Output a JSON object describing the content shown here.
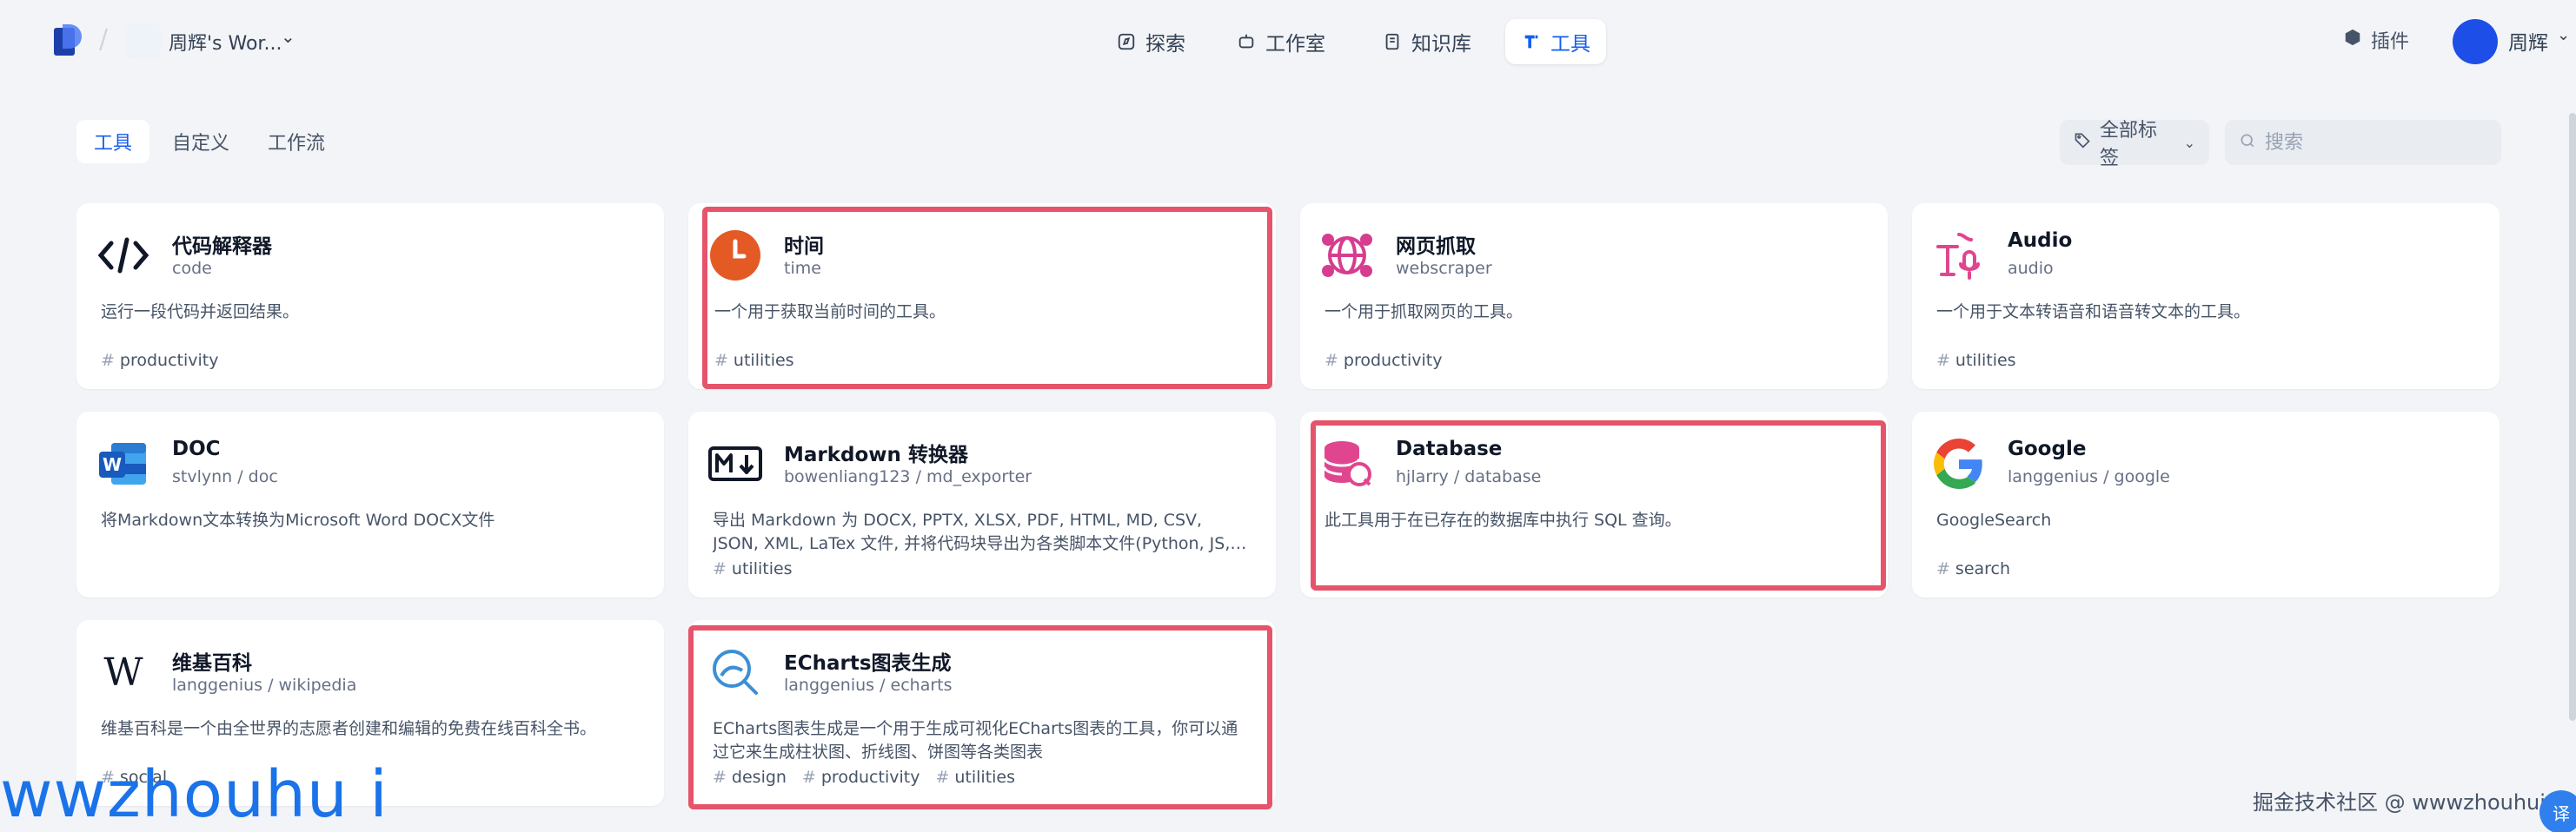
{
  "header": {
    "workspace_name": "周辉's Wor...",
    "nav": [
      {
        "label": "探索"
      },
      {
        "label": "工作室"
      },
      {
        "label": "知识库"
      },
      {
        "label": "工具"
      }
    ],
    "plugin_label": "插件",
    "user_name": "周辉"
  },
  "toolbar": {
    "tabs": [
      {
        "label": "工具"
      },
      {
        "label": "自定义"
      },
      {
        "label": "工作流"
      }
    ],
    "tag_filter_label": "全部标签",
    "search_placeholder": "搜索"
  },
  "cards": [
    {
      "name": "代码解释器",
      "sub": "code",
      "desc": "运行一段代码并返回结果。",
      "tags": [
        "productivity"
      ],
      "icon": "code-icon"
    },
    {
      "name": "时间",
      "sub": "time",
      "desc": "一个用于获取当前时间的工具。",
      "tags": [
        "utilities"
      ],
      "icon": "clock-icon"
    },
    {
      "name": "网页抓取",
      "sub": "webscraper",
      "desc": "一个用于抓取网页的工具。",
      "tags": [
        "productivity"
      ],
      "icon": "globe-icon"
    },
    {
      "name": "Audio",
      "sub": "audio",
      "desc": "一个用于文本转语音和语音转文本的工具。",
      "tags": [
        "utilities"
      ],
      "icon": "audio-icon"
    },
    {
      "name": "DOC",
      "sub": "stvlynn / doc",
      "desc": "将Markdown文本转换为Microsoft Word DOCX文件",
      "tags": [],
      "icon": "word-icon"
    },
    {
      "name": "Markdown 转换器",
      "sub": "bowenliang123 / md_exporter",
      "desc": "导出 Markdown 为 DOCX, PPTX, XLSX, PDF, HTML, MD, CSV, JSON, XML, LaTex 文件, 并将代码块导出为各类脚本文件(Python, JS, Bash...",
      "tags": [
        "utilities"
      ],
      "icon": "markdown-icon"
    },
    {
      "name": "Database",
      "sub": "hjlarry / database",
      "desc": "此工具用于在已存在的数据库中执行 SQL 查询。",
      "tags": [],
      "icon": "database-icon"
    },
    {
      "name": "Google",
      "sub": "langgenius / google",
      "desc": "GoogleSearch",
      "tags": [
        "search"
      ],
      "icon": "google-icon"
    },
    {
      "name": "维基百科",
      "sub": "langgenius / wikipedia",
      "desc": "维基百科是一个由全世界的志愿者创建和编辑的免费在线百科全书。",
      "tags": [
        "social"
      ],
      "icon": "wikipedia-icon"
    },
    {
      "name": "ECharts图表生成",
      "sub": "langgenius / echarts",
      "desc": "ECharts图表生成是一个用于生成可视化ECharts图表的工具，你可以通过它来生成柱状图、折线图、饼图等各类图表",
      "tags": [
        "design",
        "productivity",
        "utilities"
      ],
      "icon": "echarts-icon"
    }
  ],
  "watermark_left": "wwzhouhu i",
  "watermark_right": "掘金技术社区 @ wwwzhouhui",
  "translate_label": "译",
  "colors": {
    "accent": "#155eef",
    "highlight": "#e5546a"
  }
}
